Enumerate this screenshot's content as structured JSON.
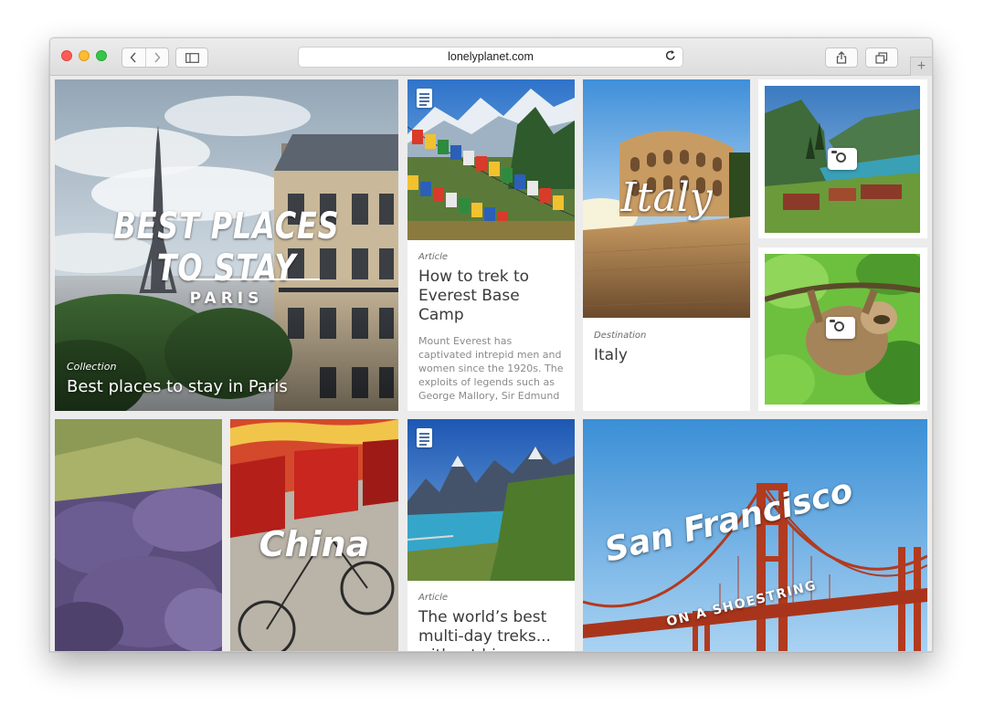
{
  "browser": {
    "url": "lonelyplanet.com",
    "new_tab_label": "+"
  },
  "tiles": {
    "paris": {
      "hero_title": "BEST PLACES TO STAY",
      "hero_subtitle": "PARIS",
      "eyebrow": "Collection",
      "title": "Best places to stay in Paris"
    },
    "everest": {
      "eyebrow": "Article",
      "title": "How to trek to Everest Base Camp",
      "description": "Mount Everest has captivated intrepid men and women since the 1920s. The exploits of legends such as George Mallory, Sir Edmund Hillary and Tenzing Norgay have"
    },
    "italy": {
      "script_title": "Italy",
      "eyebrow": "Destination",
      "title": "Italy"
    },
    "china": {
      "script_title": "China"
    },
    "treks": {
      "eyebrow": "Article",
      "title": "The world’s best multi-day treks... without big"
    },
    "sanfrancisco": {
      "script_title": "San Francisco",
      "subtitle": "ON A SHOESTRING"
    }
  },
  "colors": {
    "accent_blue": "#4a6fa5",
    "sky": "#6aa6df"
  }
}
